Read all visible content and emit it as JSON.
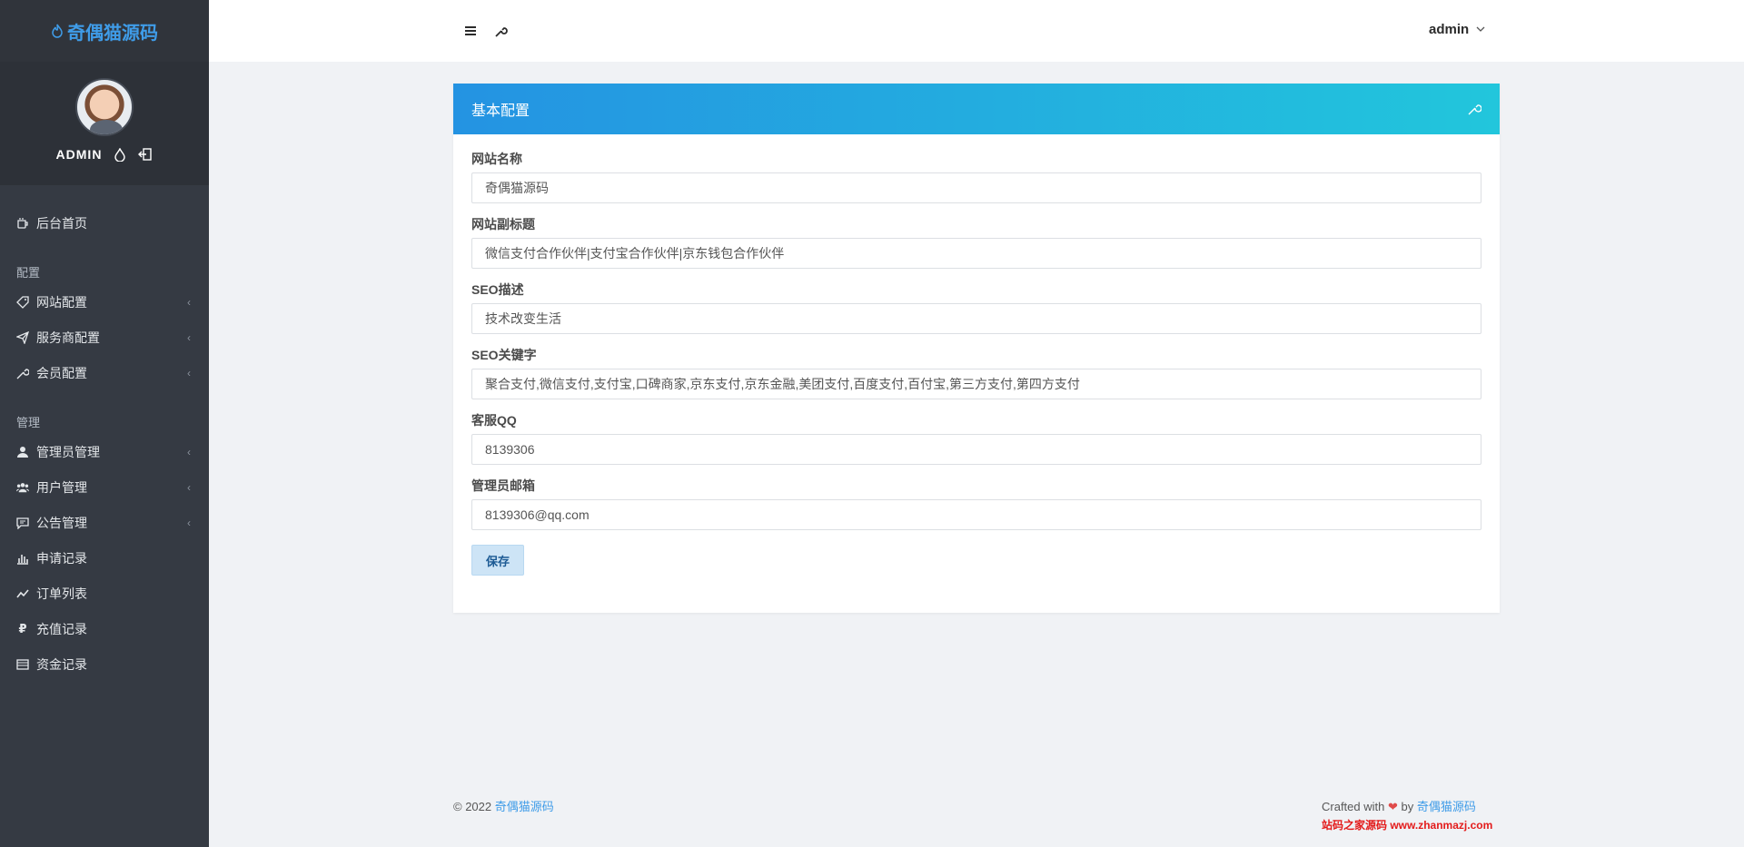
{
  "brand": {
    "name": "奇偶猫源码"
  },
  "profile": {
    "name": "ADMIN"
  },
  "nav": {
    "home": "后台首页",
    "section_config": "配置",
    "site_config": "网站配置",
    "provider_config": "服务商配置",
    "member_config": "会员配置",
    "section_manage": "管理",
    "admin_manage": "管理员管理",
    "user_manage": "用户管理",
    "notice_manage": "公告管理",
    "apply_records": "申请记录",
    "order_list": "订单列表",
    "recharge_records": "充值记录",
    "fund_records": "资金记录"
  },
  "header": {
    "user": "admin"
  },
  "card": {
    "title": "基本配置",
    "fields": [
      {
        "label": "网站名称",
        "value": "奇偶猫源码"
      },
      {
        "label": "网站副标题",
        "value": "微信支付合作伙伴|支付宝合作伙伴|京东钱包合作伙伴"
      },
      {
        "label": "SEO描述",
        "value": "技术改变生活"
      },
      {
        "label": "SEO关键字",
        "value": "聚合支付,微信支付,支付宝,口碑商家,京东支付,京东金融,美团支付,百度支付,百付宝,第三方支付,第四方支付"
      },
      {
        "label": "客服QQ",
        "value": "8139306"
      },
      {
        "label": "管理员邮箱",
        "value": "8139306@qq.com"
      }
    ],
    "save": "保存"
  },
  "footer": {
    "copyright": "© 2022",
    "site_link": "奇偶猫源码",
    "crafted": "Crafted with",
    "heart": "❤",
    "by": "by",
    "author": "奇偶猫源码",
    "watermark": "站码之家源码 www.zhanmazj.com"
  },
  "colors": {
    "accent": "#3f9ce8",
    "sidebar": "#353a43",
    "header_gradient_start": "#2493e2",
    "header_gradient_end": "#22c6dc"
  }
}
